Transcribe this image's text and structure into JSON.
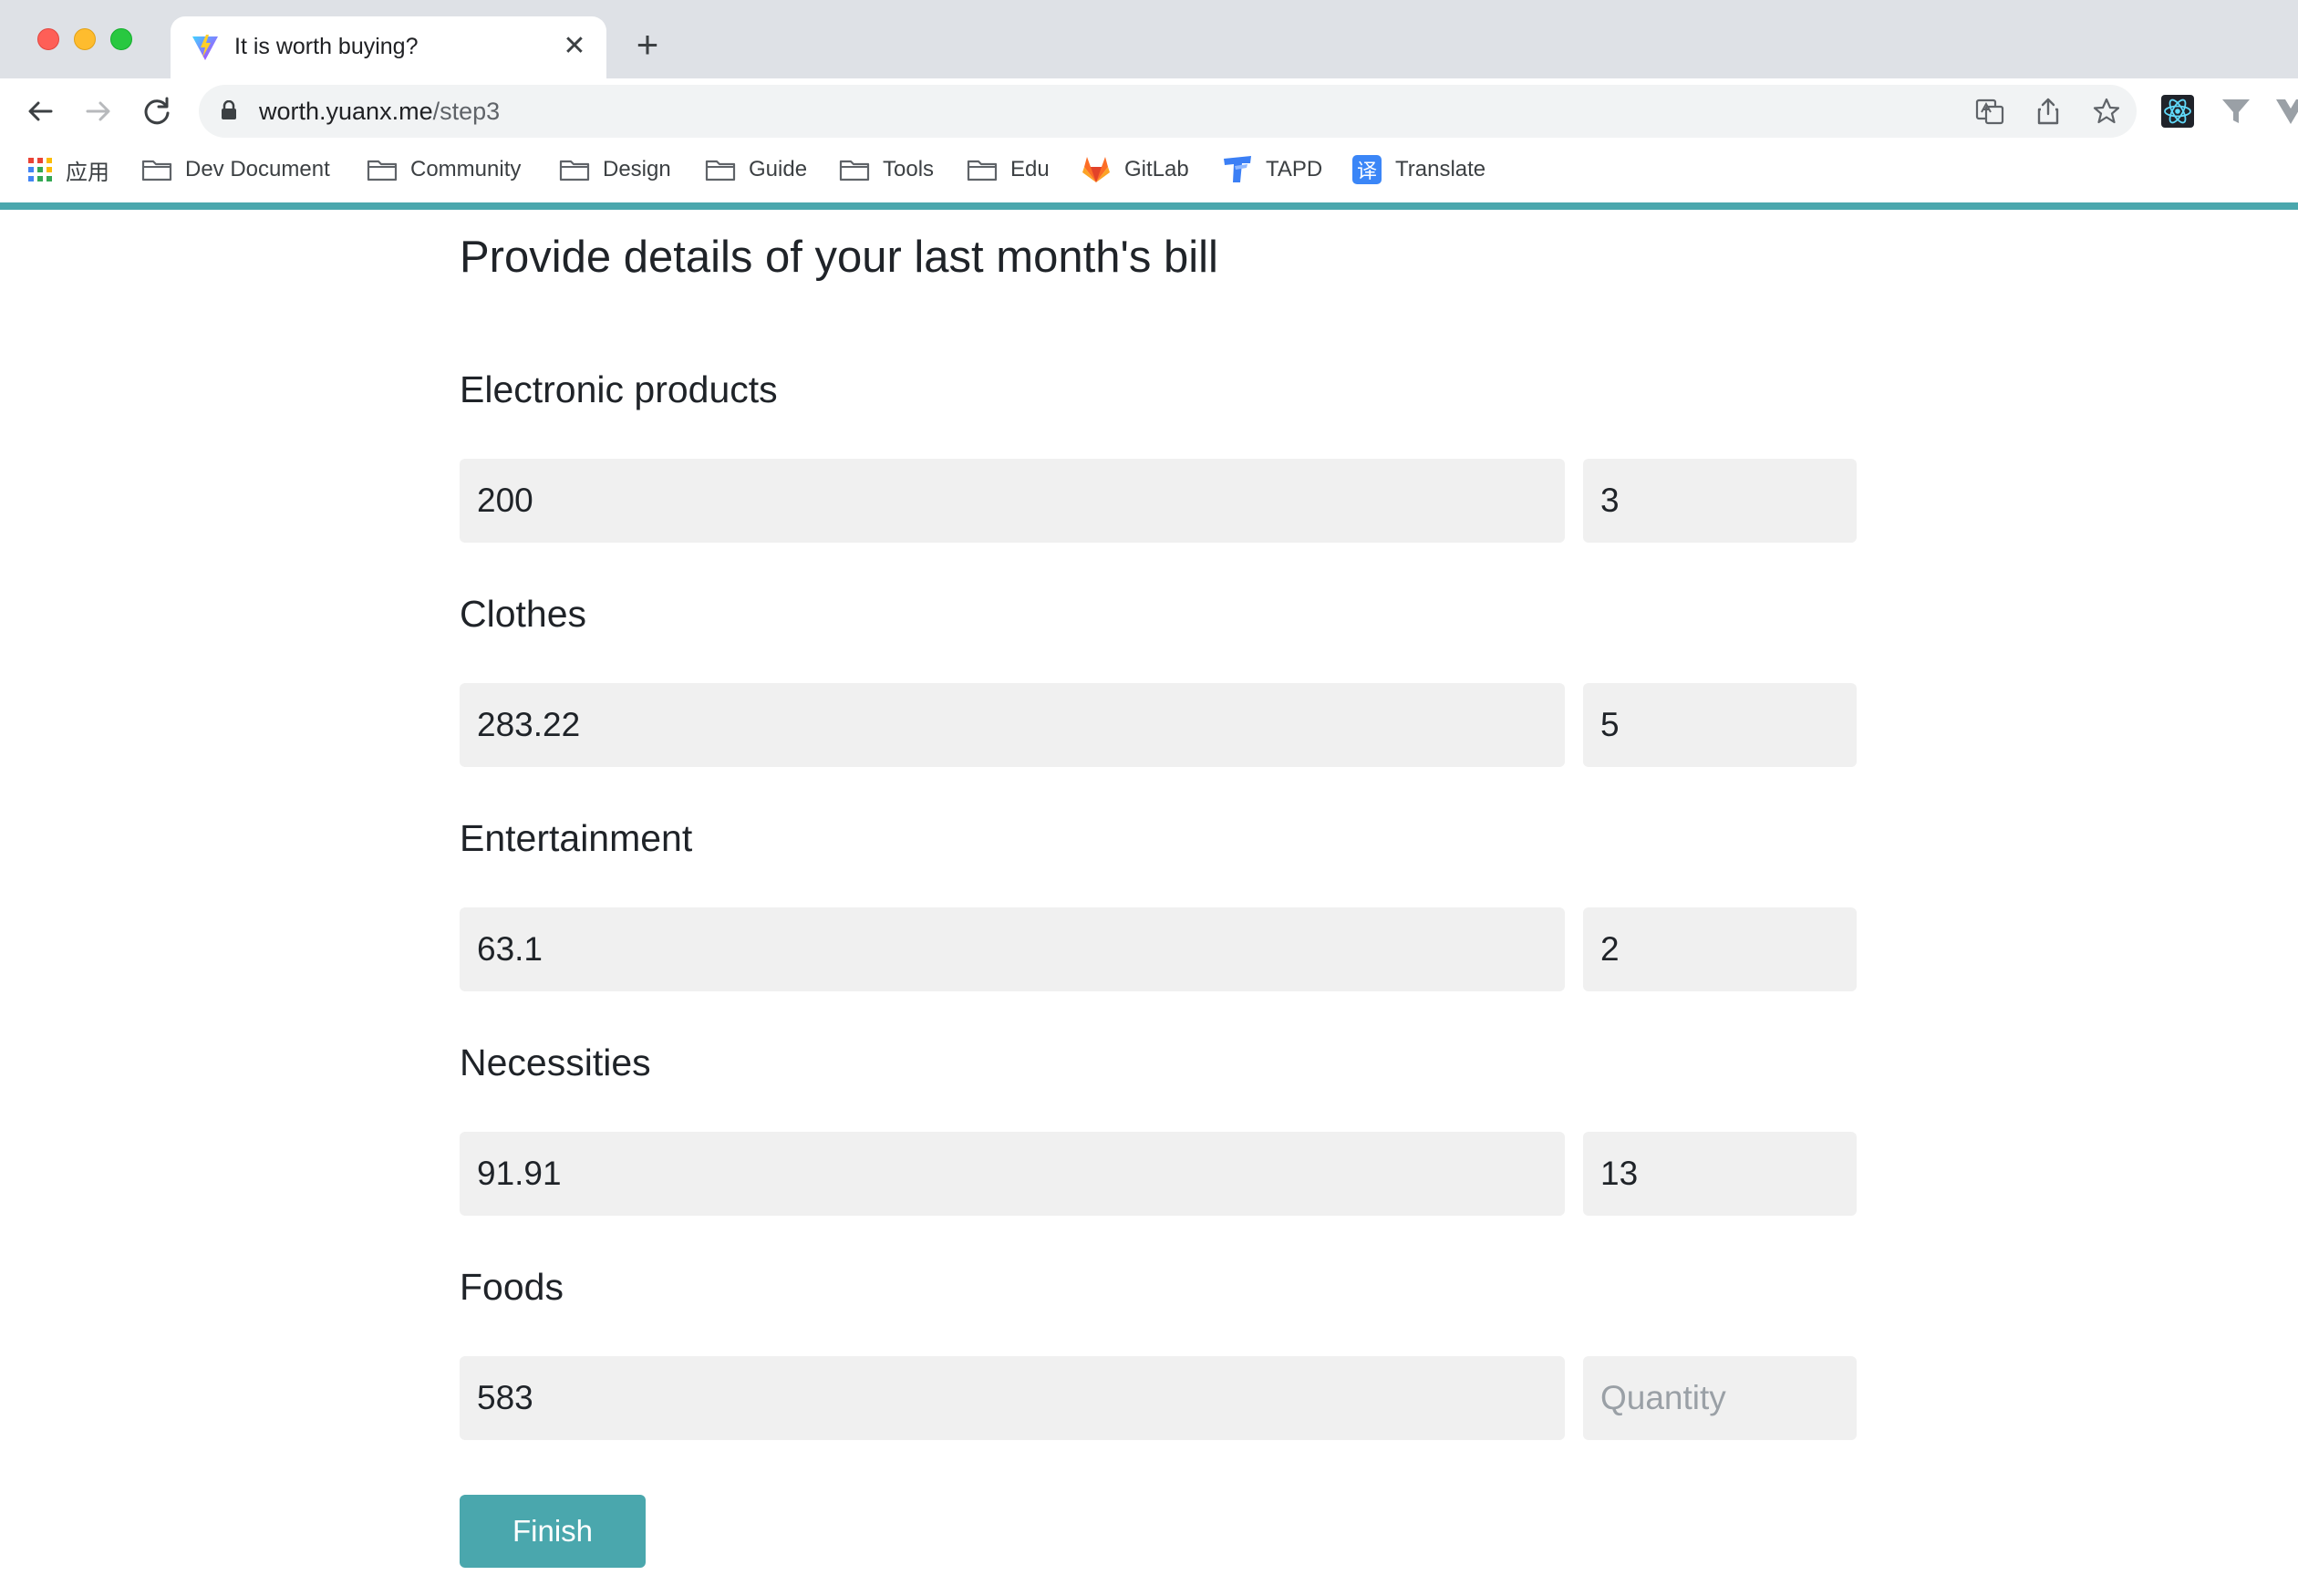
{
  "browser": {
    "tab": {
      "title": "It is worth buying?",
      "close_glyph": "✕"
    },
    "new_tab_glyph": "+",
    "address": {
      "host": "worth.yuanx.me",
      "path": "/step3"
    },
    "bookmarks": [
      {
        "label": "应用",
        "icon": "apps-grid-icon"
      },
      {
        "label": "Dev Document",
        "icon": "folder-icon"
      },
      {
        "label": "Community",
        "icon": "folder-icon"
      },
      {
        "label": "Design",
        "icon": "folder-icon"
      },
      {
        "label": "Guide",
        "icon": "folder-icon"
      },
      {
        "label": "Tools",
        "icon": "folder-icon"
      },
      {
        "label": "Edu",
        "icon": "folder-icon"
      },
      {
        "label": "GitLab",
        "icon": "gitlab-icon"
      },
      {
        "label": "TAPD",
        "icon": "tapd-icon"
      },
      {
        "label": "Translate",
        "icon": "translate-icon"
      }
    ],
    "accent_color": "#4aa7ad"
  },
  "page": {
    "title": "Provide details of your last month's bill",
    "categories": [
      {
        "label": "Electronic products",
        "amount": "200",
        "quantity": "3"
      },
      {
        "label": "Clothes",
        "amount": "283.22",
        "quantity": "5"
      },
      {
        "label": "Entertainment",
        "amount": "63.1",
        "quantity": "2"
      },
      {
        "label": "Necessities",
        "amount": "91.91",
        "quantity": "13"
      },
      {
        "label": "Foods",
        "amount": "583",
        "quantity": ""
      }
    ],
    "quantity_placeholder": "Quantity",
    "finish_label": "Finish"
  }
}
